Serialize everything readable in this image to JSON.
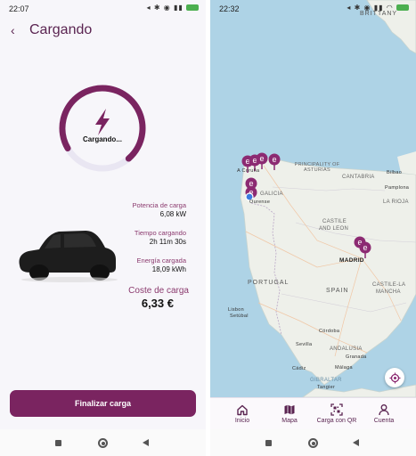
{
  "left_screen": {
    "status_time": "22:07",
    "title": "Cargando",
    "gauge_label": "Cargando...",
    "stats": [
      {
        "label": "Potencia de carga",
        "value": "6,08 kW"
      },
      {
        "label": "Tiempo cargando",
        "value": "2h 11m 30s"
      },
      {
        "label": "Energía cargada",
        "value": "18,09 kWh"
      }
    ],
    "cost_label": "Coste de carga",
    "cost_value": "6,33 €",
    "finish_button": "Finalizar carga",
    "gauge_progress": 0.72,
    "colors": {
      "accent": "#7a2460",
      "accent_light": "#8b3a6e",
      "gauge_track": "#e9e6f2"
    }
  },
  "right_screen": {
    "status_time": "22:32",
    "map_labels": {
      "top": "BRITTANY",
      "coruna": "A Coruña",
      "galicia": "GALICIA",
      "ourense": "Ourense",
      "asturias": "PRINCIPALITY OF ASTURIAS",
      "cantabria": "CANTABRIA",
      "bilbao": "Bilbao",
      "pamplona": "Pamplona",
      "rioja": "LA RIOJA",
      "castile_leon_1": "CASTILE",
      "castile_leon_2": "AND LEON",
      "madrid": "MADRID",
      "portugal": "PORTUGAL",
      "spain": "SPAIN",
      "clm_1": "CASTILE-LA",
      "clm_2": "MANCHA",
      "lisbon": "Lisbon",
      "setubal": "Setúbal",
      "cordoba": "Córdoba",
      "sevilla": "Sevilla",
      "andalusia": "ANDALUSIA",
      "granada": "Granada",
      "cadiz": "Cádiz",
      "malaga": "Málaga",
      "gibraltar": "GIBRALTAR",
      "tangier": "Tangier"
    },
    "tabs": [
      {
        "label": "Inicio",
        "icon": "home-icon"
      },
      {
        "label": "Mapa",
        "icon": "map-icon"
      },
      {
        "label": "Carga con QR",
        "icon": "qr-icon"
      },
      {
        "label": "Cuenta",
        "icon": "user-icon"
      }
    ],
    "colors": {
      "sea": "#aed3e6",
      "land": "#eef0ea",
      "pin": "#8c2a72"
    }
  }
}
